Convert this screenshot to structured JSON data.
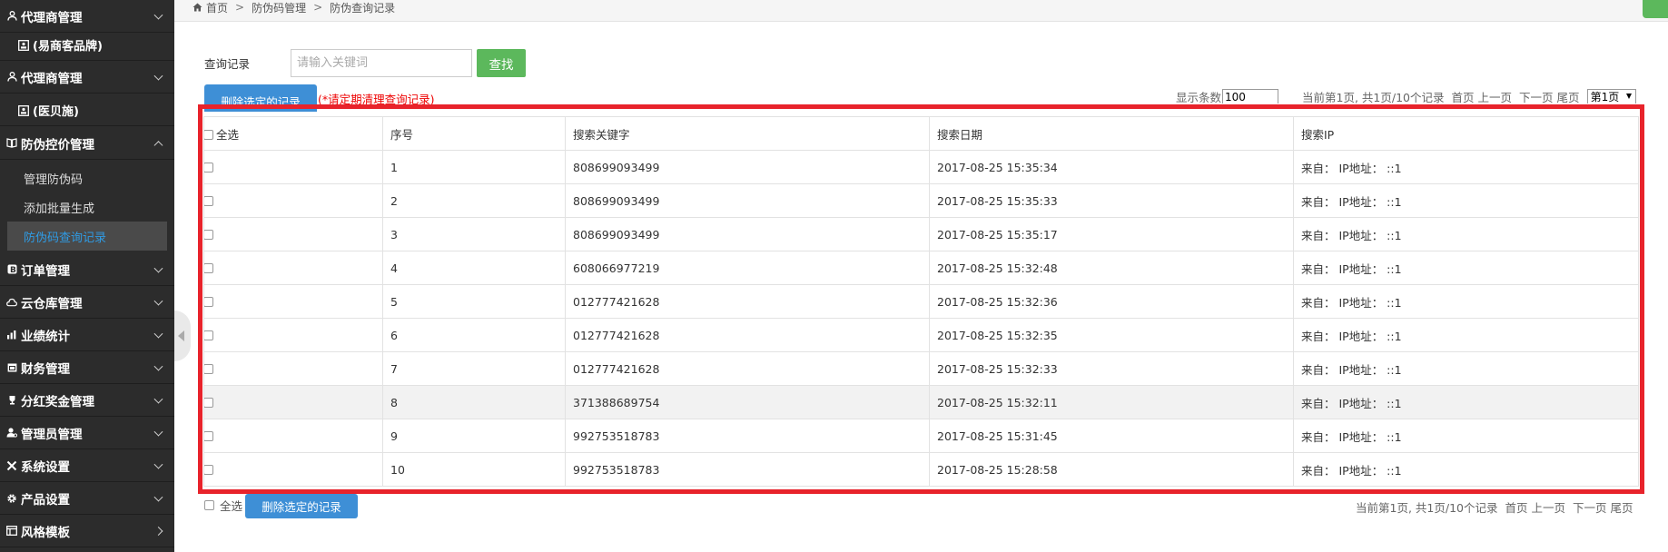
{
  "sidebar": {
    "items": [
      {
        "label": "代理商管理",
        "icon": "user-icon",
        "chevron": "down"
      },
      {
        "label": "(易商客品牌)",
        "icon": "id-card-icon"
      },
      {
        "label": "代理商管理",
        "icon": "user-icon",
        "chevron": "down"
      },
      {
        "label": "(医贝施)",
        "icon": "id-card-icon"
      },
      {
        "label": "防伪控价管理",
        "icon": "book-icon",
        "chevron": "up"
      },
      {
        "label": "管理防伪码"
      },
      {
        "label": "添加批量生成"
      },
      {
        "label": "防伪码查询记录",
        "active": true
      },
      {
        "label": "订单管理",
        "icon": "bold-b-icon",
        "chevron": "down"
      },
      {
        "label": "云仓库管理",
        "icon": "cloud-icon",
        "chevron": "down"
      },
      {
        "label": "业绩统计",
        "icon": "bar-chart-icon",
        "chevron": "down"
      },
      {
        "label": "财务管理",
        "icon": "calendar-icon",
        "chevron": "down"
      },
      {
        "label": "分红奖金管理",
        "icon": "trophy-icon",
        "chevron": "down"
      },
      {
        "label": "管理员管理",
        "icon": "admin-user-icon",
        "chevron": "down"
      },
      {
        "label": "系统设置",
        "icon": "wrench-icon",
        "chevron": "down"
      },
      {
        "label": "产品设置",
        "icon": "gear-icon",
        "chevron": "down"
      },
      {
        "label": "风格模板",
        "icon": "template-icon",
        "chevron": "right"
      }
    ]
  },
  "breadcrumb": {
    "home": "首页",
    "sep": ">",
    "level1": "防伪码管理",
    "level2": "防伪查询记录"
  },
  "search": {
    "label": "查询记录",
    "placeholder": "请输入关键词",
    "value": "",
    "button": "查找"
  },
  "toolbar": {
    "delete_label": "删除选定的记录",
    "warning": "(*请定期清理查询记录)",
    "page_size_label": "显示条数",
    "page_size": "100",
    "page_info": "当前第1页, 共1页/10个记录",
    "first": "首页",
    "prev": "上一页",
    "next": "下一页",
    "last": "尾页",
    "page_select": "第1页"
  },
  "table": {
    "headers": [
      "全选",
      "序号",
      "搜索关键字",
      "搜索日期",
      "搜索IP"
    ],
    "rows": [
      {
        "no": "1",
        "keyword": "808699093499",
        "date": "2017-08-25 15:35:34",
        "ip": "来自： IP地址： ::1"
      },
      {
        "no": "2",
        "keyword": "808699093499",
        "date": "2017-08-25 15:35:33",
        "ip": "来自： IP地址： ::1"
      },
      {
        "no": "3",
        "keyword": "808699093499",
        "date": "2017-08-25 15:35:17",
        "ip": "来自： IP地址： ::1"
      },
      {
        "no": "4",
        "keyword": "608066977219",
        "date": "2017-08-25 15:32:48",
        "ip": "来自： IP地址： ::1"
      },
      {
        "no": "5",
        "keyword": "012777421628",
        "date": "2017-08-25 15:32:36",
        "ip": "来自： IP地址： ::1"
      },
      {
        "no": "6",
        "keyword": "012777421628",
        "date": "2017-08-25 15:32:35",
        "ip": "来自： IP地址： ::1"
      },
      {
        "no": "7",
        "keyword": "012777421628",
        "date": "2017-08-25 15:32:33",
        "ip": "来自： IP地址： ::1"
      },
      {
        "no": "8",
        "keyword": "371388689754",
        "date": "2017-08-25 15:32:11",
        "ip": "来自： IP地址： ::1"
      },
      {
        "no": "9",
        "keyword": "992753518783",
        "date": "2017-08-25 15:31:45",
        "ip": "来自： IP地址： ::1"
      },
      {
        "no": "10",
        "keyword": "992753518783",
        "date": "2017-08-25 15:28:58",
        "ip": "来自： IP地址： ::1"
      }
    ]
  },
  "footer": {
    "select_all": "全选",
    "delete_label": "删除选定的记录",
    "page_info": "当前第1页, 共1页/10个记录",
    "first": "首页",
    "prev": "上一页",
    "next": "下一页",
    "last": "尾页"
  },
  "colors": {
    "sidebar_bg": "#2c2c2c",
    "active_link": "#2f9be4",
    "primary": "#3e8fd6",
    "success": "#5cb85c",
    "highlight": "#e8232b",
    "warning_text": "#e00000"
  }
}
